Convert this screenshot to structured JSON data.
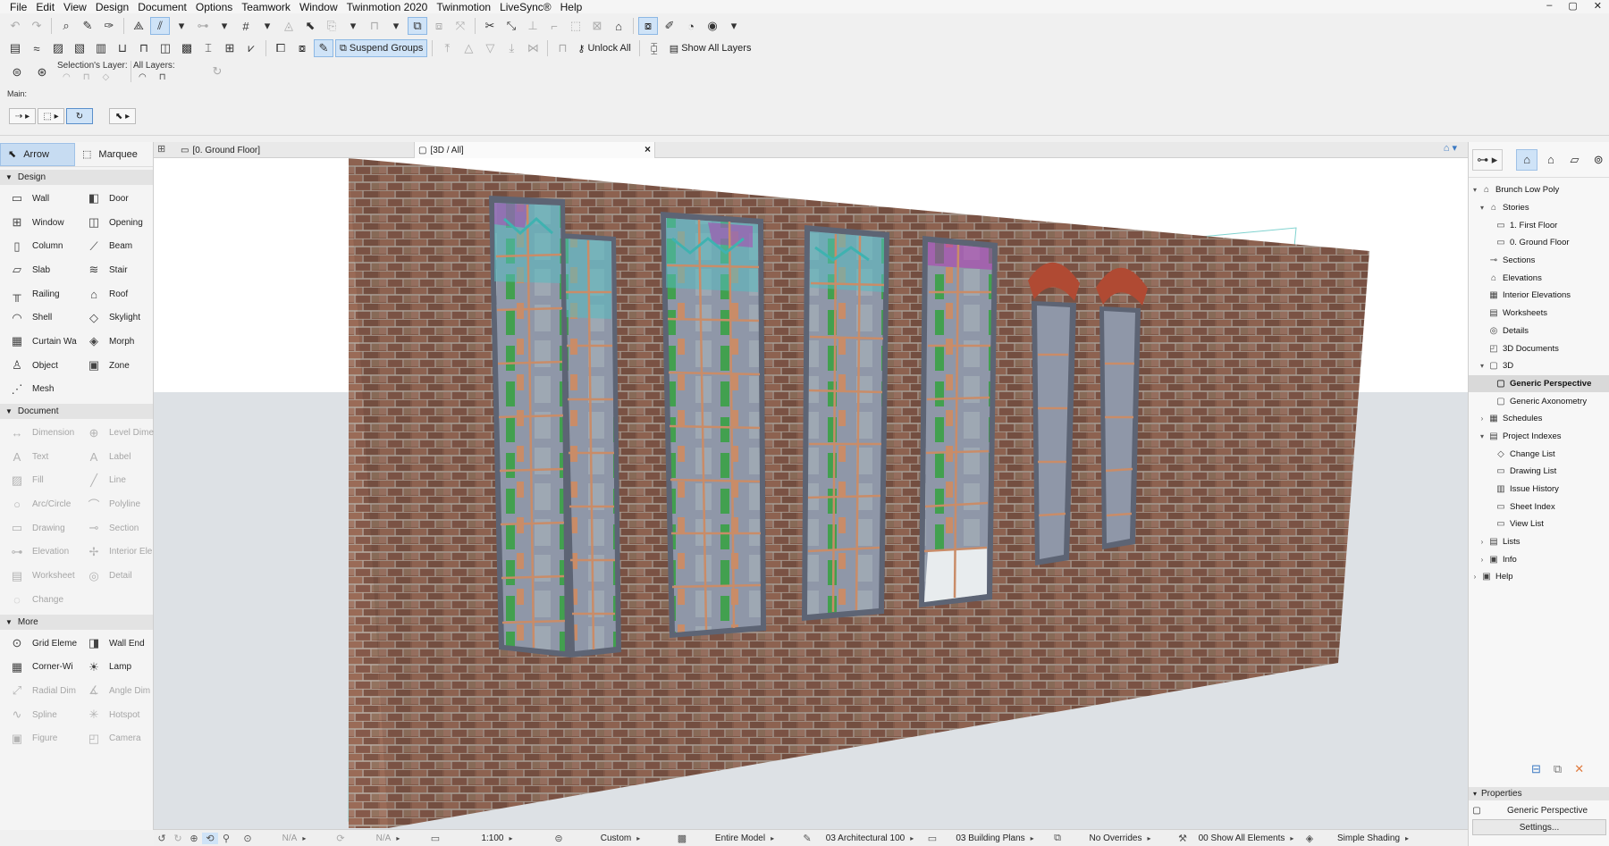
{
  "menu": [
    "File",
    "Edit",
    "View",
    "Design",
    "Document",
    "Options",
    "Teamwork",
    "Window",
    "Twinmotion 2020",
    "Twinmotion",
    "LiveSync®",
    "Help"
  ],
  "window_controls": [
    "–",
    "▢",
    "✕"
  ],
  "toolbar2": {
    "suspend_groups": "Suspend Groups",
    "unlock_all": "Unlock All",
    "show_all_layers": "Show All Layers"
  },
  "layers": {
    "selection_label": "Selection's Layer:",
    "all_label": "All Layers:"
  },
  "main_label": "Main:",
  "toolbox": {
    "arrow": "Arrow",
    "marquee": "Marquee",
    "sections": [
      {
        "title": "Design",
        "tools": [
          {
            "label": "Wall",
            "icon": "▭",
            "enabled": true
          },
          {
            "label": "Door",
            "icon": "◧",
            "enabled": true
          },
          {
            "label": "Window",
            "icon": "⊞",
            "enabled": true
          },
          {
            "label": "Opening",
            "icon": "◫",
            "enabled": true
          },
          {
            "label": "Column",
            "icon": "▯",
            "enabled": true
          },
          {
            "label": "Beam",
            "icon": "⟋",
            "enabled": true
          },
          {
            "label": "Slab",
            "icon": "▱",
            "enabled": true
          },
          {
            "label": "Stair",
            "icon": "≋",
            "enabled": true
          },
          {
            "label": "Railing",
            "icon": "╥",
            "enabled": true
          },
          {
            "label": "Roof",
            "icon": "⌂",
            "enabled": true
          },
          {
            "label": "Shell",
            "icon": "◠",
            "enabled": true
          },
          {
            "label": "Skylight",
            "icon": "◇",
            "enabled": true
          },
          {
            "label": "Curtain Wa",
            "icon": "▦",
            "enabled": true
          },
          {
            "label": "Morph",
            "icon": "◈",
            "enabled": true
          },
          {
            "label": "Object",
            "icon": "♙",
            "enabled": true
          },
          {
            "label": "Zone",
            "icon": "▣",
            "enabled": true
          },
          {
            "label": "Mesh",
            "icon": "⋰",
            "enabled": true
          }
        ]
      },
      {
        "title": "Document",
        "tools": [
          {
            "label": "Dimension",
            "icon": "↔",
            "enabled": false
          },
          {
            "label": "Level Dime",
            "icon": "⊕",
            "enabled": false
          },
          {
            "label": "Text",
            "icon": "A",
            "enabled": false
          },
          {
            "label": "Label",
            "icon": "A",
            "enabled": false
          },
          {
            "label": "Fill",
            "icon": "▨",
            "enabled": false
          },
          {
            "label": "Line",
            "icon": "╱",
            "enabled": false
          },
          {
            "label": "Arc/Circle",
            "icon": "○",
            "enabled": false
          },
          {
            "label": "Polyline",
            "icon": "⌒",
            "enabled": false
          },
          {
            "label": "Drawing",
            "icon": "▭",
            "enabled": false
          },
          {
            "label": "Section",
            "icon": "⊸",
            "enabled": false
          },
          {
            "label": "Elevation",
            "icon": "⊶",
            "enabled": false
          },
          {
            "label": "Interior Ele",
            "icon": "✢",
            "enabled": false
          },
          {
            "label": "Worksheet",
            "icon": "▤",
            "enabled": false
          },
          {
            "label": "Detail",
            "icon": "◎",
            "enabled": false
          },
          {
            "label": "Change",
            "icon": "◌",
            "enabled": false
          }
        ]
      },
      {
        "title": "More",
        "tools": [
          {
            "label": "Grid Eleme",
            "icon": "⊙",
            "enabled": true
          },
          {
            "label": "Wall End",
            "icon": "◨",
            "enabled": true
          },
          {
            "label": "Corner-Wi",
            "icon": "▦",
            "enabled": true
          },
          {
            "label": "Lamp",
            "icon": "☀",
            "enabled": true
          },
          {
            "label": "Radial Dim",
            "icon": "⤢",
            "enabled": false
          },
          {
            "label": "Angle Dim",
            "icon": "∡",
            "enabled": false
          },
          {
            "label": "Spline",
            "icon": "∿",
            "enabled": false
          },
          {
            "label": "Hotspot",
            "icon": "✳",
            "enabled": false
          },
          {
            "label": "Figure",
            "icon": "▣",
            "enabled": false
          },
          {
            "label": "Camera",
            "icon": "◰",
            "enabled": false
          }
        ]
      }
    ]
  },
  "tabs": [
    {
      "label": "[0. Ground Floor]",
      "active": false
    },
    {
      "label": "[3D / All]",
      "active": true
    }
  ],
  "tab_close": "×",
  "statusbar": {
    "na1": "N/A",
    "na2": "N/A",
    "scale": "1:100",
    "layer_combo": "Custom",
    "model": "Entire Model",
    "pen_set": "03 Architectural 100",
    "mvo": "03 Building Plans",
    "overrides": "No Overrides",
    "renovation": "00 Show All Elements",
    "shading": "Simple Shading"
  },
  "navigator": {
    "tree": [
      {
        "label": "Brunch Low Poly",
        "depth": 0,
        "twisty": "▾",
        "icon": "⌂",
        "selected": false
      },
      {
        "label": "Stories",
        "depth": 1,
        "twisty": "▾",
        "icon": "⌂",
        "selected": false
      },
      {
        "label": "1. First Floor",
        "depth": 2,
        "twisty": "",
        "icon": "▭",
        "selected": false
      },
      {
        "label": "0. Ground Floor",
        "depth": 2,
        "twisty": "",
        "icon": "▭",
        "selected": false
      },
      {
        "label": "Sections",
        "depth": 1,
        "twisty": "",
        "icon": "⊸",
        "selected": false
      },
      {
        "label": "Elevations",
        "depth": 1,
        "twisty": "",
        "icon": "⌂",
        "selected": false
      },
      {
        "label": "Interior Elevations",
        "depth": 1,
        "twisty": "",
        "icon": "▦",
        "selected": false
      },
      {
        "label": "Worksheets",
        "depth": 1,
        "twisty": "",
        "icon": "▤",
        "selected": false
      },
      {
        "label": "Details",
        "depth": 1,
        "twisty": "",
        "icon": "◎",
        "selected": false
      },
      {
        "label": "3D Documents",
        "depth": 1,
        "twisty": "",
        "icon": "◰",
        "selected": false
      },
      {
        "label": "3D",
        "depth": 1,
        "twisty": "▾",
        "icon": "▢",
        "selected": false
      },
      {
        "label": "Generic Perspective",
        "depth": 2,
        "twisty": "",
        "icon": "▢",
        "selected": true
      },
      {
        "label": "Generic Axonometry",
        "depth": 2,
        "twisty": "",
        "icon": "▢",
        "selected": false
      },
      {
        "label": "Schedules",
        "depth": 1,
        "twisty": "›",
        "icon": "▦",
        "selected": false
      },
      {
        "label": "Project Indexes",
        "depth": 1,
        "twisty": "▾",
        "icon": "▤",
        "selected": false
      },
      {
        "label": "Change List",
        "depth": 2,
        "twisty": "",
        "icon": "◇",
        "selected": false
      },
      {
        "label": "Drawing List",
        "depth": 2,
        "twisty": "",
        "icon": "▭",
        "selected": false
      },
      {
        "label": "Issue History",
        "depth": 2,
        "twisty": "",
        "icon": "▥",
        "selected": false
      },
      {
        "label": "Sheet Index",
        "depth": 2,
        "twisty": "",
        "icon": "▭",
        "selected": false
      },
      {
        "label": "View List",
        "depth": 2,
        "twisty": "",
        "icon": "▭",
        "selected": false
      },
      {
        "label": "Lists",
        "depth": 1,
        "twisty": "›",
        "icon": "▤",
        "selected": false
      },
      {
        "label": "Info",
        "depth": 1,
        "twisty": "›",
        "icon": "▣",
        "selected": false
      },
      {
        "label": "Help",
        "depth": 0,
        "twisty": "›",
        "icon": "▣",
        "selected": false
      }
    ]
  },
  "properties": {
    "title": "Properties",
    "name": "Generic Perspective",
    "settings_button": "Settings..."
  },
  "colors": {
    "selection_blue": "#cfe3f7",
    "brick": "#8a5b48",
    "window_frame": "#5d6474",
    "mullion": "#c98c68",
    "steel_teal": "#3fb2b0",
    "magenta_accent": "#b339b0",
    "green_accent": "#3aa34a"
  }
}
